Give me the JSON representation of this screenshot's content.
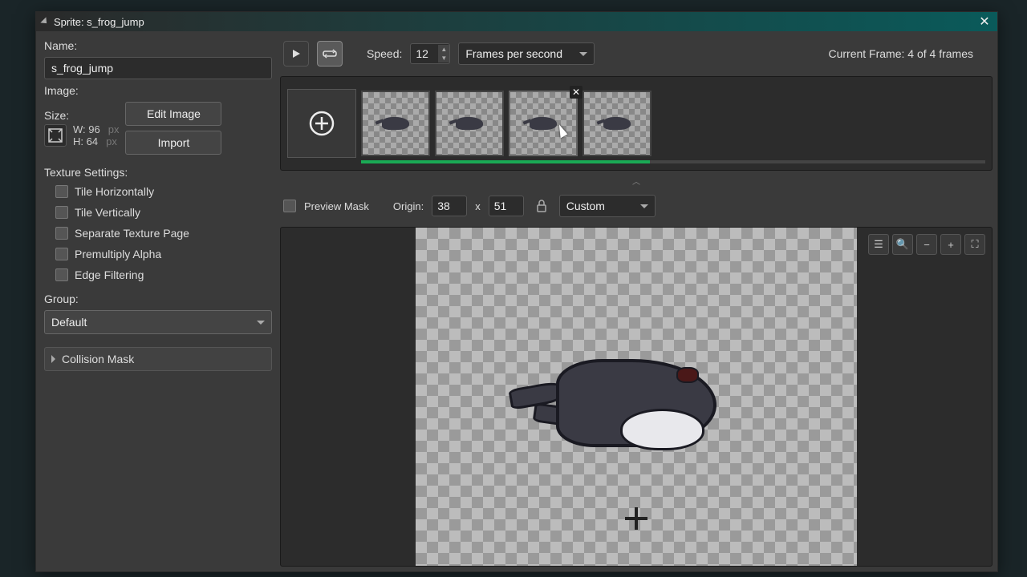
{
  "window": {
    "title": "Sprite: s_frog_jump"
  },
  "left": {
    "name_label": "Name:",
    "name_value": "s_frog_jump",
    "image_label": "Image:",
    "size_label": "Size:",
    "size_w_label": "W:",
    "size_w_value": "96",
    "size_h_label": "H:",
    "size_h_value": "64",
    "px_unit": "px",
    "edit_image": "Edit Image",
    "import": "Import",
    "texture_label": "Texture Settings:",
    "tex_tile_h": "Tile Horizontally",
    "tex_tile_v": "Tile Vertically",
    "tex_sep_page": "Separate Texture Page",
    "tex_premult": "Premultiply Alpha",
    "tex_edge": "Edge Filtering",
    "group_label": "Group:",
    "group_value": "Default",
    "collision_mask": "Collision Mask"
  },
  "toolbar": {
    "speed_label": "Speed:",
    "speed_value": "12",
    "speed_unit": "Frames per second",
    "frame_status": "Current Frame: 4 of 4 frames"
  },
  "origin": {
    "preview_mask": "Preview Mask",
    "origin_label": "Origin:",
    "origin_x": "38",
    "origin_sep": "x",
    "origin_y": "51",
    "mode": "Custom"
  }
}
